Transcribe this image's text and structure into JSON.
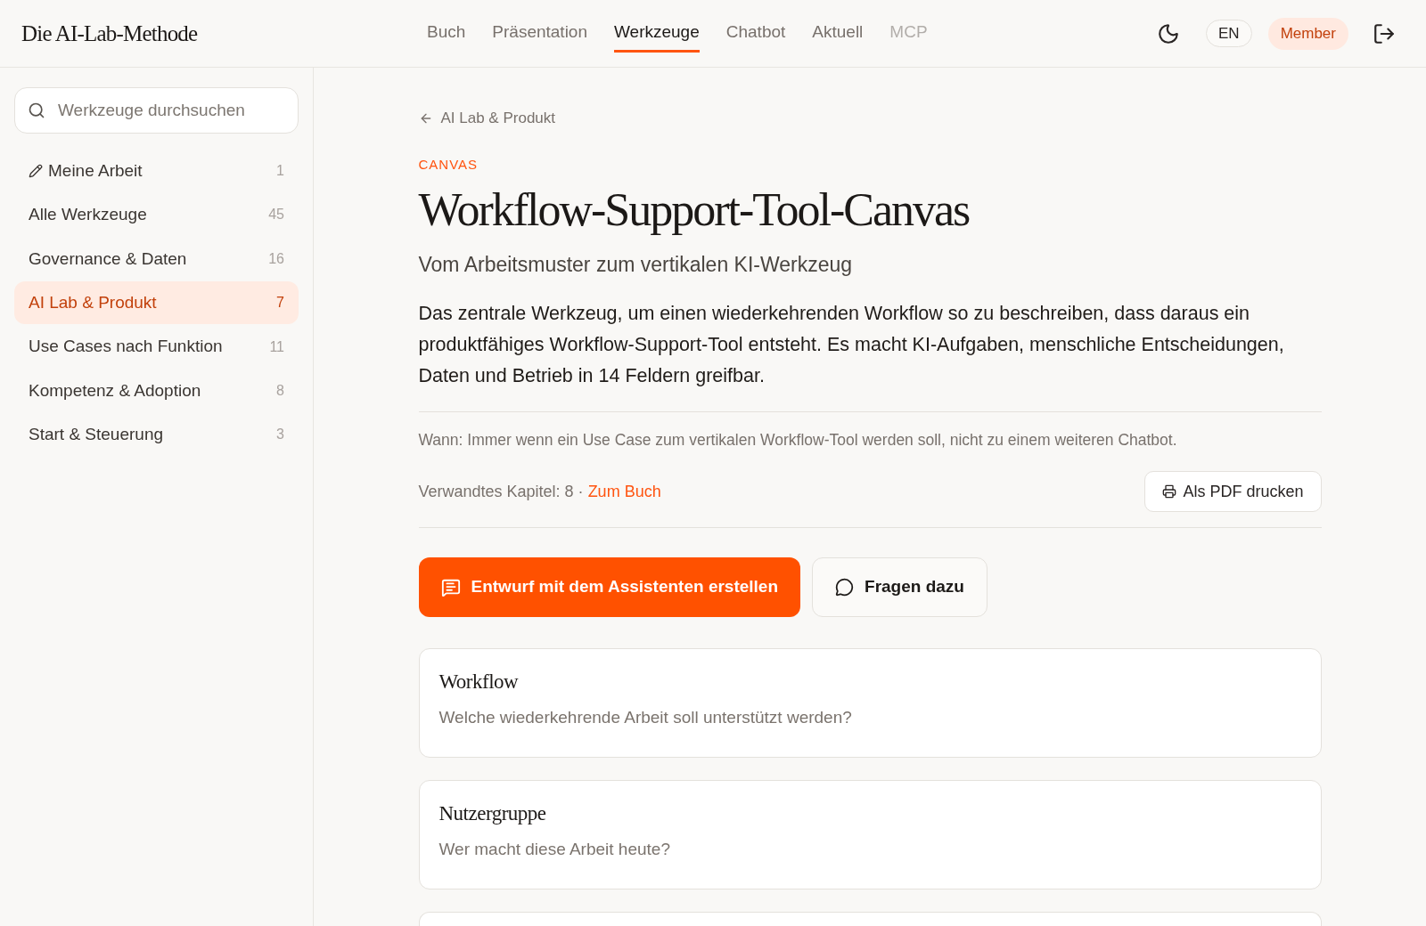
{
  "header": {
    "logo": "Die AI-Lab-Methode",
    "nav": [
      {
        "label": "Buch",
        "selected": false,
        "disabled": false
      },
      {
        "label": "Präsentation",
        "selected": false,
        "disabled": false
      },
      {
        "label": "Werkzeuge",
        "selected": true,
        "disabled": false
      },
      {
        "label": "Chatbot",
        "selected": false,
        "disabled": false
      },
      {
        "label": "Aktuell",
        "selected": false,
        "disabled": false
      },
      {
        "label": "MCP",
        "selected": false,
        "disabled": true
      }
    ],
    "language": "EN",
    "member_badge": "Member"
  },
  "sidebar": {
    "search": {
      "placeholder": "Werkzeuge durchsuchen"
    },
    "items": [
      {
        "kind": "personal",
        "label": "Meine Arbeit",
        "count": "1",
        "selected": false
      },
      {
        "kind": "category",
        "label": "Alle Werkzeuge",
        "count": "45",
        "selected": false
      },
      {
        "kind": "category",
        "label": "Governance & Daten",
        "count": "16",
        "selected": false
      },
      {
        "kind": "category",
        "label": "AI Lab & Produkt",
        "count": "7",
        "selected": true
      },
      {
        "kind": "category",
        "label": "Use Cases nach Funktion",
        "count": "11",
        "selected": false
      },
      {
        "kind": "category",
        "label": "Kompetenz & Adoption",
        "count": "8",
        "selected": false
      },
      {
        "kind": "category",
        "label": "Start & Steuerung",
        "count": "3",
        "selected": false
      }
    ]
  },
  "main": {
    "breadcrumb": "AI Lab & Produkt",
    "eyebrow": "CANVAS",
    "title": "Workflow-Support-Tool-Canvas",
    "subtitle": "Vom Arbeitsmuster zum vertikalen KI-Werkzeug",
    "description": "Das zentrale Werkzeug, um einen wiederkehrenden Workflow so zu beschreiben, dass daraus ein produktfähiges Workflow-Support-Tool entsteht. Es macht KI-Aufgaben, menschliche Entscheidungen, Daten und Betrieb in 14 Feldern greifbar.",
    "when": "Wann: Immer wenn ein Use Case zum vertikalen Workflow-Tool werden soll, nicht zu einem weiteren Chatbot.",
    "related": {
      "text": "Verwandtes Kapitel: 8 ·",
      "link": "Zum Buch"
    },
    "print_button": "Als PDF drucken",
    "actions": [
      {
        "kind": "primary",
        "label": "Entwurf mit dem Assistenten erstellen"
      },
      {
        "kind": "secondary",
        "label": "Fragen dazu"
      }
    ],
    "fields": [
      {
        "kind": "field",
        "title": "Workflow",
        "question": "Welche wiederkehrende Arbeit soll unterstützt werden?"
      },
      {
        "kind": "field",
        "title": "Nutzergruppe",
        "question": "Wer macht diese Arbeit heute?"
      },
      {
        "kind": "cut_off"
      }
    ]
  }
}
